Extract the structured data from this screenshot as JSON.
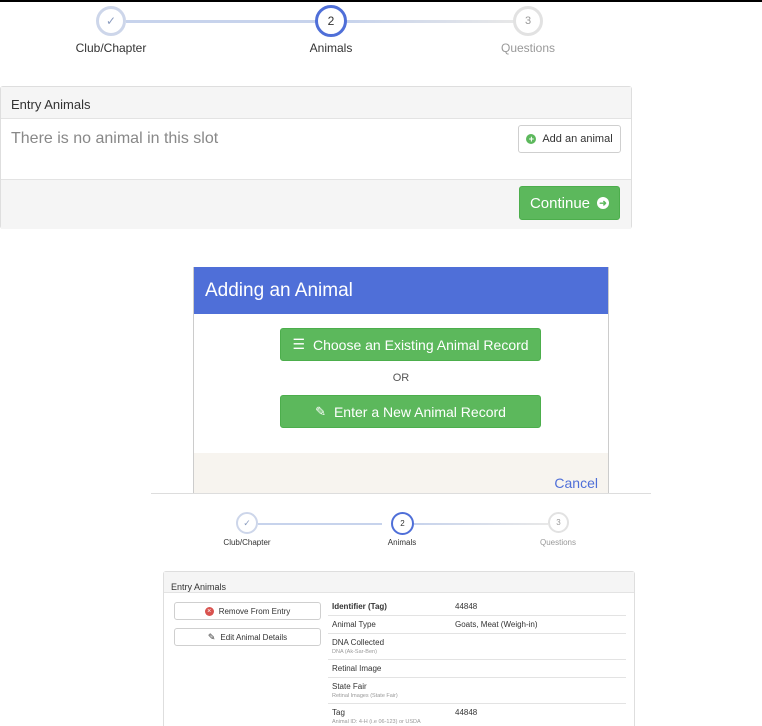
{
  "stepper_top": {
    "steps": [
      {
        "label": "Club/Chapter",
        "number": "✓"
      },
      {
        "label": "Animals",
        "number": "2"
      },
      {
        "label": "Questions",
        "number": "3"
      }
    ]
  },
  "entry_panel": {
    "heading": "Entry Animals",
    "empty_text": "There is no animal in this slot",
    "add_button": "Add an animal",
    "continue_button": "Continue"
  },
  "modal": {
    "title": "Adding an Animal",
    "choose_button": "Choose an Existing Animal Record",
    "or_text": "OR",
    "new_button": "Enter a New Animal Record",
    "cancel": "Cancel"
  },
  "stepper_bottom": {
    "steps": [
      {
        "label": "Club/Chapter",
        "number": "✓"
      },
      {
        "label": "Animals",
        "number": "2"
      },
      {
        "label": "Questions",
        "number": "3"
      }
    ]
  },
  "detail_panel": {
    "heading": "Entry Animals",
    "remove_button": "Remove From Entry",
    "edit_button": "Edit Animal Details",
    "rows": [
      {
        "label": "Identifier (Tag)",
        "sub": "",
        "value": "44848"
      },
      {
        "label": "Animal Type",
        "sub": "",
        "value": "Goats, Meat (Weigh-in)"
      },
      {
        "label": "DNA Collected",
        "sub": "DNA (Ak-Sar-Ben)",
        "value": ""
      },
      {
        "label": "Retinal Image",
        "sub": "",
        "value": ""
      },
      {
        "label": "State Fair",
        "sub": "Retinal Images (State Fair)",
        "value": ""
      },
      {
        "label": "Tag",
        "sub": "Animal ID: 4-H (i.e 06-123) or USDA",
        "value": "44848"
      }
    ]
  },
  "colors": {
    "accent_blue": "#4f6fd8",
    "step_line": "#c7d3ec",
    "success_green": "#5cb85c",
    "danger_red": "#d9534f"
  }
}
